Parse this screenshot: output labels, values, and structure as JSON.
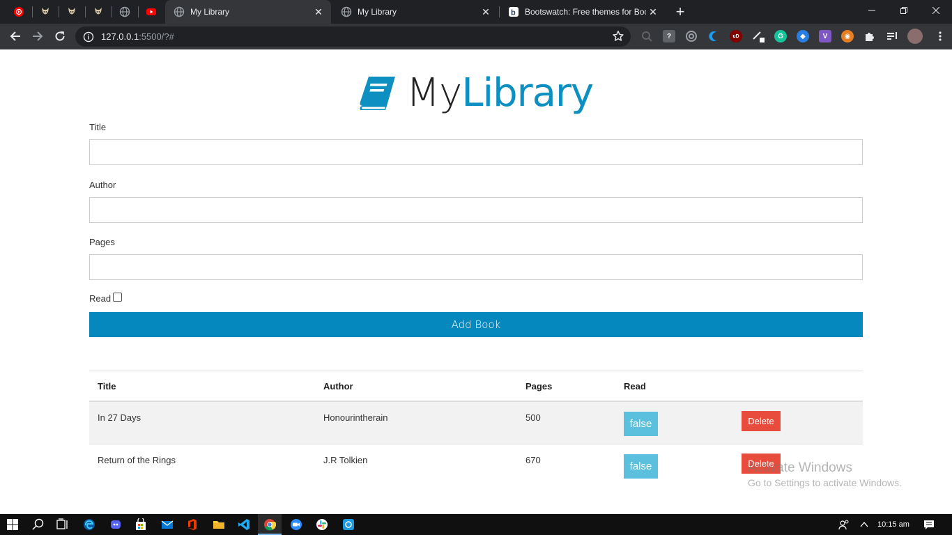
{
  "browser": {
    "tabs": [
      {
        "title": "My Library",
        "active": true
      },
      {
        "title": "My Library",
        "active": false
      },
      {
        "title": "Bootswatch: Free themes for Boo",
        "active": false
      }
    ],
    "new_tab_label": "+",
    "url_host": "127.0.0.1",
    "url_rest": ":5500/?#"
  },
  "app": {
    "brand_my": "My",
    "brand_library": "Library",
    "form": {
      "title_label": "Title",
      "author_label": "Author",
      "pages_label": "Pages",
      "read_label": "Read",
      "add_button": "Add Book"
    },
    "table": {
      "headers": {
        "title": "Title",
        "author": "Author",
        "pages": "Pages",
        "read": "Read"
      },
      "rows": [
        {
          "title": "In 27 Days",
          "author": "Honourintherain",
          "pages": "500",
          "read": "false",
          "delete": "Delete"
        },
        {
          "title": "Return of the Rings",
          "author": "J.R Tolkien",
          "pages": "670",
          "read": "false",
          "delete": "Delete"
        }
      ]
    }
  },
  "watermark": {
    "line1": "Activate Windows",
    "line2": "Go to Settings to activate Windows."
  },
  "taskbar": {
    "time": "10:15 am"
  },
  "colors": {
    "accent": "#0488bd",
    "info": "#5bc0de",
    "danger": "#e74c3c"
  }
}
